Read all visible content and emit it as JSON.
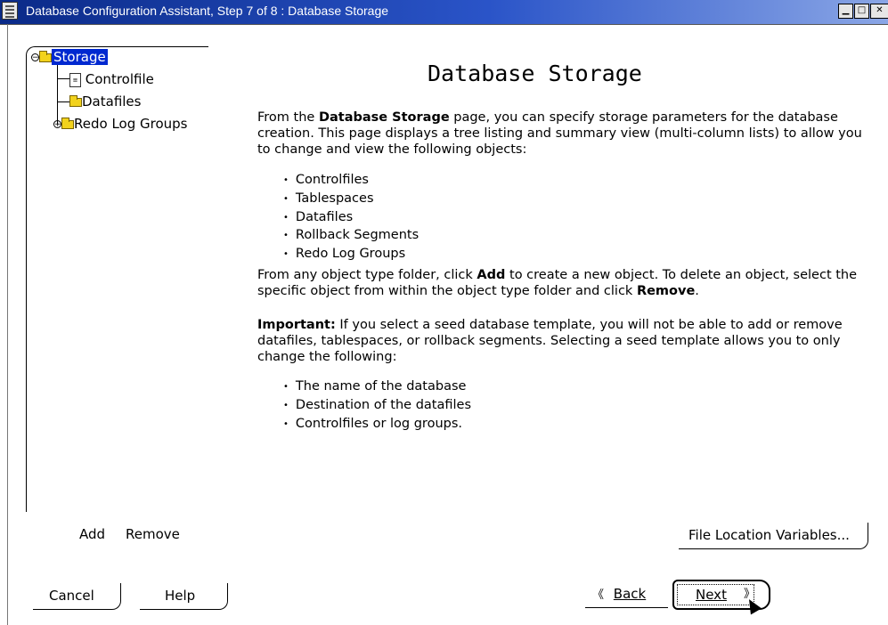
{
  "window": {
    "title": "Database Configuration Assistant, Step 7 of 8 : Database Storage",
    "controls": [
      "minimize",
      "maximize",
      "close"
    ]
  },
  "tree": {
    "root": "Storage",
    "items": [
      {
        "label": "Controlfile",
        "icon": "document-icon"
      },
      {
        "label": "Datafiles",
        "icon": "folder-icon"
      },
      {
        "label": "Redo Log Groups",
        "icon": "folder-icon"
      }
    ]
  },
  "tree_actions": {
    "add": "Add",
    "remove": "Remove"
  },
  "main": {
    "title": "Database Storage",
    "intro_prefix": "From the ",
    "intro_bold": "Database Storage",
    "intro_suffix": " page, you can specify storage parameters for the database creation. This page displays a tree listing and summary view (multi-column lists) to allow you to change and view the following objects:",
    "objects": [
      "Controlfiles",
      "Tablespaces",
      "Datafiles",
      "Rollback Segments",
      "Redo Log Groups"
    ],
    "add_prefix": "From any object type folder, click ",
    "add_bold": "Add",
    "add_mid": " to create a new object. To delete an object, select the specific object from within the object type folder and click ",
    "remove_bold": "Remove",
    "add_end": ".",
    "important_bold": "Important:",
    "important_text": " If you select a seed database template, you will not be able to add or remove datafiles, tablespaces, or rollback segments. Selecting a seed template allows you to only change the following:",
    "changes": [
      "The name of the database",
      "Destination of the datafiles",
      "Controlfiles or log groups."
    ]
  },
  "buttons": {
    "file_location": "File Location Variables...",
    "cancel": "Cancel",
    "help": "Help",
    "back": "Back",
    "next": "Next"
  },
  "colors": {
    "titlebar": "#0a2a88",
    "selection": "#0028d0",
    "folder": "#f2d21c"
  }
}
